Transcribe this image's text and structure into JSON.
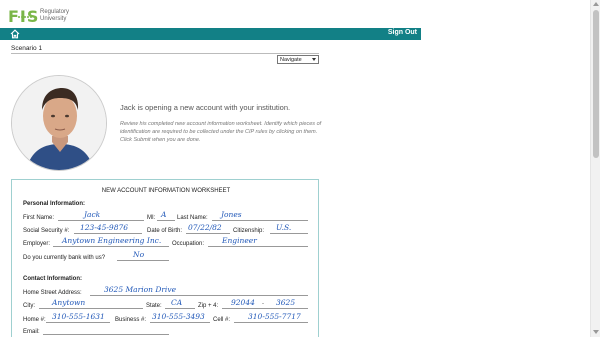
{
  "header": {
    "logo_mark": "FIS",
    "logo_line1": "Regulatory",
    "logo_line2": "University",
    "brand_color": "#7ab648"
  },
  "navbar": {
    "color": "#128086",
    "home_icon": "home-icon",
    "signout_label": "Sign Out"
  },
  "scenario": {
    "title": "Scenario 1",
    "navigate_value": "Navigate"
  },
  "intro": {
    "headline": "Jack is opening a new account with your institution.",
    "instructions": "Review his completed new account information worksheet. Identify which pieces of identification are required to be collected under the CIP rules by clicking on them. Click Submit when you are done."
  },
  "worksheet": {
    "title": "NEW ACCOUNT INFORMATION WORKSHEET",
    "personal_heading": "Personal Information:",
    "first_name_label": "First Name:",
    "first_name": "Jack",
    "mi_label": "MI:",
    "mi": "A",
    "last_name_label": "Last Name:",
    "last_name": "Jones",
    "ssn_label": "Social Security #:",
    "ssn": "123-45-9876",
    "dob_label": "Date of Birth:",
    "dob": "07/22/82",
    "citizenship_label": "Citizenship:",
    "citizenship": "U.S.",
    "employer_label": "Employer:",
    "employer": "Anytown Engineering Inc.",
    "occupation_label": "Occupation:",
    "occupation": "Engineer",
    "bank_with_us_label": "Do you currently bank with us?",
    "bank_with_us": "No",
    "contact_heading": "Contact Information:",
    "address_label": "Home Street Address:",
    "address": "3625 Marion Drive",
    "city_label": "City:",
    "city": "Anytown",
    "state_label": "State:",
    "state": "CA",
    "zip_label": "Zip + 4:",
    "zip": "92044",
    "zip_dash": "-",
    "zip4": "3625",
    "home_phone_label": "Home #:",
    "home_phone": "310-555-1631",
    "business_phone_label": "Business #:",
    "business_phone": "310-555-3493",
    "cell_phone_label": "Cell #:",
    "cell_phone": "310-555-7717",
    "email_label": "Email:",
    "handwriting_color": "#2158b8"
  }
}
